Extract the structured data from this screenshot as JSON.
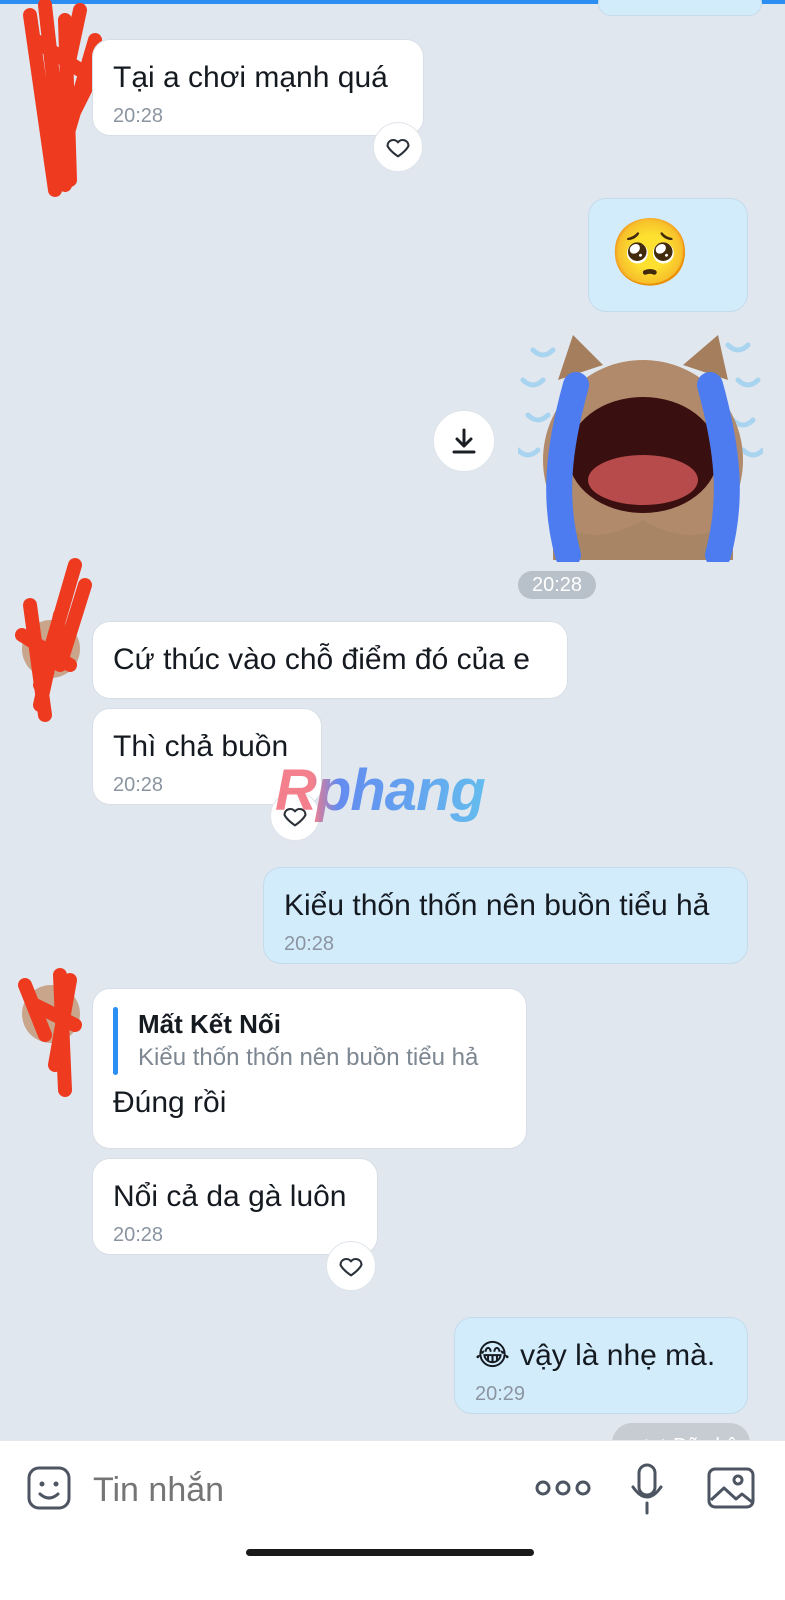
{
  "messages": {
    "m1": {
      "text": "Tại a chơi mạnh quá",
      "time": "20:28"
    },
    "m2": {
      "emoji": "🥺"
    },
    "m3": {
      "time": "20:28"
    },
    "m4": {
      "text": "Cứ thúc vào chỗ điểm đó của e"
    },
    "m5": {
      "text": "Thì chả buồn",
      "time": "20:28"
    },
    "m6": {
      "text": "Kiểu thốn thốn nên buồn tiểu hả",
      "time": "20:28"
    },
    "m7": {
      "quote_author": "Mất Kết Nối",
      "quote_text": "Kiểu thốn thốn nên buồn tiểu hả",
      "text": "Đúng rồi"
    },
    "m8": {
      "text": "Nổi cả da gà luôn",
      "time": "20:28"
    },
    "m9": {
      "emoji": "😂",
      "text": "vậy là nhẹ mà.",
      "time": "20:29"
    }
  },
  "watermark": "Rphang",
  "status_partial": "✓✓ Đã nhận",
  "input": {
    "placeholder": "Tin nhắn"
  },
  "icons": [
    "sticker-icon",
    "more-icon",
    "mic-icon",
    "image-icon",
    "heart-icon",
    "download-icon"
  ],
  "colors": {
    "background": "#e1e7ef",
    "outgoing_bubble": "#d3ecfc",
    "incoming_bubble": "#ffffff",
    "accent": "#2a8ef2"
  }
}
